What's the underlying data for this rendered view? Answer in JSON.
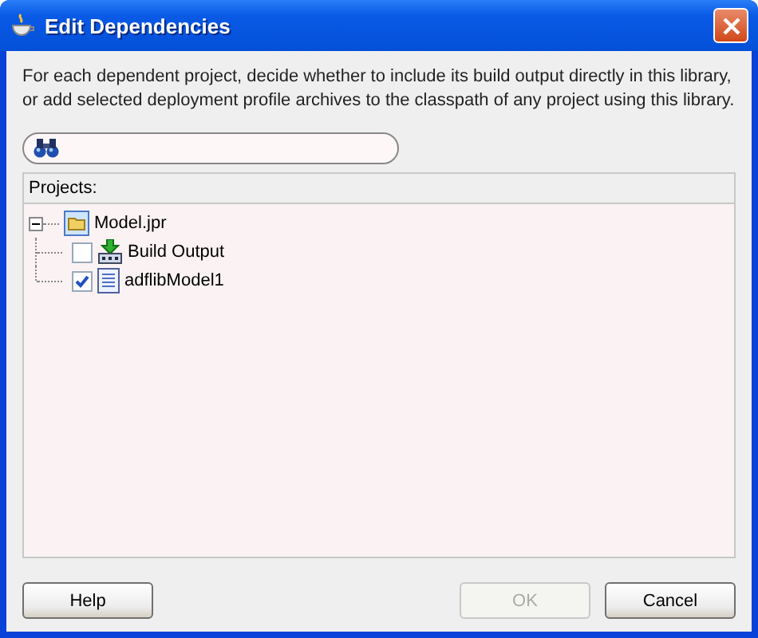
{
  "window": {
    "title": "Edit Dependencies"
  },
  "description": "For each dependent project, decide whether to include its build output directly in this library, or add selected deployment profile archives to the classpath of any project using this library.",
  "projects": {
    "label": "Projects:",
    "tree": [
      {
        "label": "Model.jpr",
        "kind": "project",
        "expanded": true,
        "children": [
          {
            "label": "Build Output",
            "kind": "build",
            "checked": false
          },
          {
            "label": "adflibModel1",
            "kind": "archive",
            "checked": true
          }
        ]
      }
    ]
  },
  "buttons": [
    {
      "label": "Help",
      "disabled": false
    },
    {
      "label": "OK",
      "disabled": true
    },
    {
      "label": "Cancel",
      "disabled": false
    }
  ]
}
